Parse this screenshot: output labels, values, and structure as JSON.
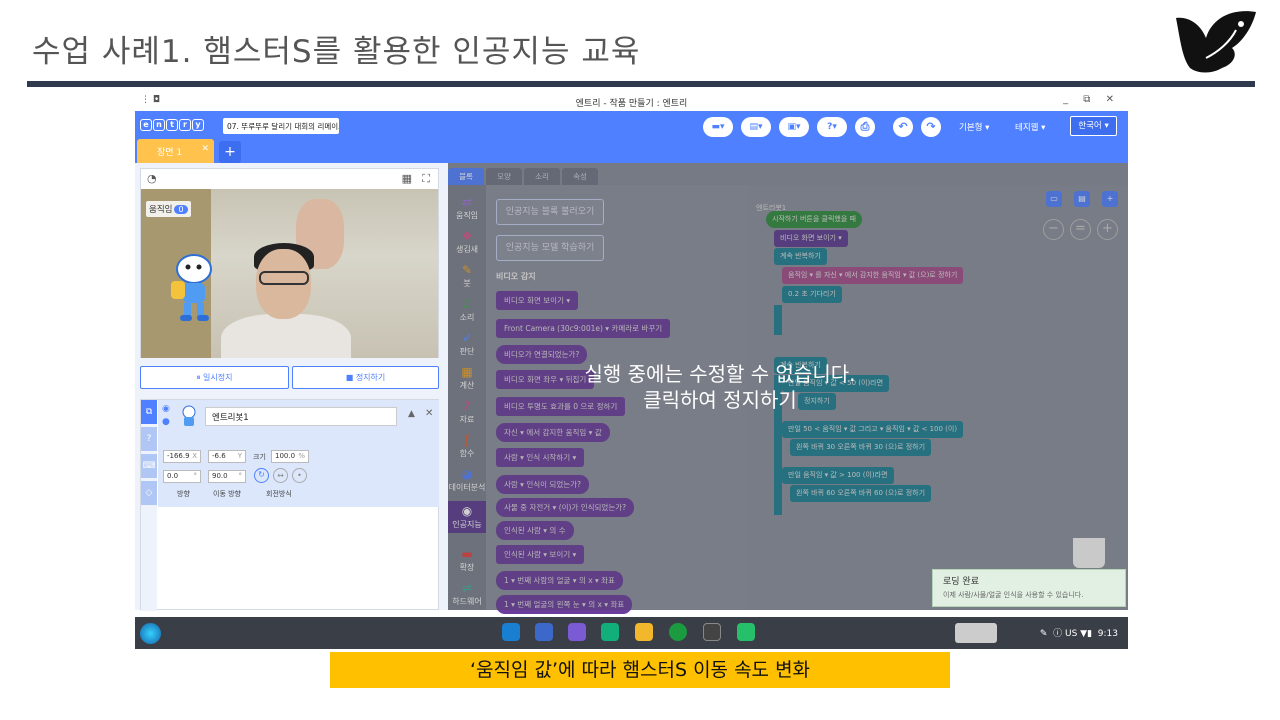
{
  "slide": {
    "title": "수업 사례1. 햄스터S를 활용한 인공지능 교육",
    "caption": "‘움직임 값’에 따라 햄스터S 이동 속도 변화"
  },
  "window": {
    "title": "엔트리 - 작품 만들기 : 엔트리",
    "controls": "_ ⧉ ✕"
  },
  "toolbar": {
    "project_name": "07. 뚜루뚜루 달리기 대회의 리메이크",
    "mode": "기본형",
    "theme": "테지웹",
    "language": "한국어",
    "help": "?"
  },
  "scene": {
    "tab_label": "장면 1",
    "close": "✕",
    "add": "+"
  },
  "stage": {
    "variable_label": "움직임",
    "variable_value": "0",
    "pause_button": "⏸ 일시정지",
    "stop_button": "■ 정지하기"
  },
  "object": {
    "name": "엔트리봇1",
    "x": "-166.9",
    "x_unit": "X",
    "y": "-6.6",
    "y_unit": "Y",
    "size_label": "크기",
    "size": "100.0",
    "size_unit": "%",
    "direction": "0.0",
    "direction_unit": "°",
    "move_direction": "90.0",
    "move_direction_unit": "°",
    "direction_label": "방향",
    "move_direction_label": "이동 방향",
    "rotation_label": "회전방식"
  },
  "category_tabs": [
    "블록",
    "모양",
    "소리",
    "속성"
  ],
  "categories": [
    {
      "icon": "⇄",
      "label": "움직임"
    },
    {
      "icon": "❖",
      "label": "생김새"
    },
    {
      "icon": "✎",
      "label": "붓"
    },
    {
      "icon": "♪",
      "label": "소리"
    },
    {
      "icon": "✔",
      "label": "판단"
    },
    {
      "icon": "▦",
      "label": "계산"
    },
    {
      "icon": "?",
      "label": "자료"
    },
    {
      "icon": "ƒ",
      "label": "함수"
    },
    {
      "icon": "◕",
      "label": "데이터분석"
    },
    {
      "icon": "◉",
      "label": "인공지능"
    },
    {
      "icon": "▬",
      "label": "확장"
    },
    {
      "icon": "⇌",
      "label": "하드웨어"
    }
  ],
  "palette": {
    "load_ai_blocks": "인공지능 블록 불러오기",
    "train_model": "인공지능 모델 학습하기",
    "section_title": "비디오 감지",
    "blocks": [
      "비디오 화면  보이기 ▾",
      "Front Camera (30c9:001e) ▾  카메라로 바꾸기",
      "비디오가 연결되었는가?",
      "비디오 화면  좌우 ▾  뒤집기",
      "비디오 투명도 효과를  0  으로 정하기",
      "자신 ▾  에서 감지한  움직임 ▾  값",
      "사람 ▾  인식  시작하기 ▾",
      "사람 ▾  인식이 되었는가?",
      "사물 중  자전거 ▾  (이)가 인식되었는가?",
      "인식된  사람 ▾  의 수",
      "인식된  사람 ▾  보이기 ▾",
      "1 ▾  번째 사람의  얼굴 ▾  의  x ▾  좌표",
      "1 ▾  번째 얼굴의  왼쪽 눈 ▾  의  x ▾  좌표"
    ]
  },
  "workspace": {
    "object_label": "엔트리봇1",
    "blocks": [
      "시작하기 버튼을 클릭했을 때",
      "비디오 화면  보이기 ▾",
      "계속 반복하기",
      "움직임 ▾  를  자신 ▾  에서 감지한  움직임 ▾  값  (으)로 정하기",
      "0.2  초 기다리기",
      "계속 반복하기",
      "만일  움직임 ▾  값  <  50  (이)라면",
      "정지하기",
      "만일  50  <  움직임 ▾  값  그리고 ▾  움직임 ▾  값  <  100  (이)",
      "왼쪽 바퀴  30  오른쪽 바퀴  30  (으)로 정하기",
      "만일  움직임 ▾  값  >  100  (이)라면",
      "왼쪽 바퀴  60  오른쪽 바퀴  60  (으)로 정하기"
    ],
    "zoom_out": "−",
    "zoom_reset": "=",
    "zoom_in": "+"
  },
  "overlay": {
    "line1": "실행 중에는 수정할 수 없습니다.",
    "line2": "클릭하여 정지하기"
  },
  "toast": {
    "title": "로딩 완료",
    "message": "이제 사람/사물/얼굴 인식을 사용할 수 있습니다."
  },
  "taskbar": {
    "locale": "US",
    "time": "9:13"
  },
  "colors": {
    "entry_blue": "#4f80ff",
    "caption_yellow": "#ffc000",
    "slide_bar": "#2f3a4f"
  }
}
